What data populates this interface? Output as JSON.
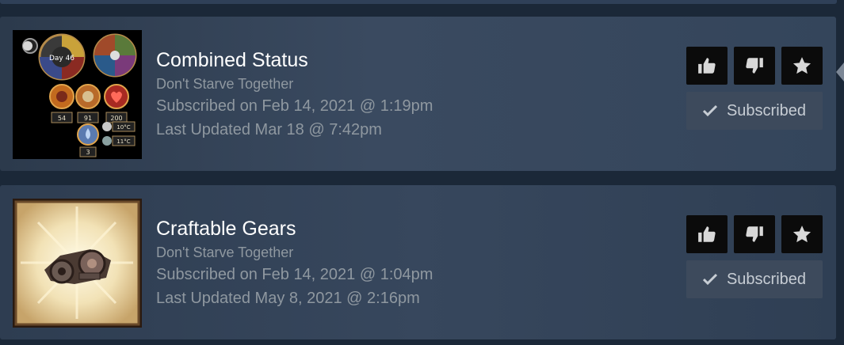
{
  "items": [
    {
      "title": "Combined Status",
      "game": "Don't Starve Together",
      "subscribed_on": "Subscribed on Feb 14, 2021 @ 1:19pm",
      "last_updated": "Last Updated Mar 18 @ 7:42pm",
      "subscribe_label": "Subscribed",
      "thumb": {
        "clock_text": "Day 46",
        "stat_values": [
          "54",
          "91",
          "200"
        ],
        "moisture_value": "3",
        "temps": [
          "10°C",
          "11°C"
        ]
      }
    },
    {
      "title": "Craftable Gears",
      "game": "Don't Starve Together",
      "subscribed_on": "Subscribed on Feb 14, 2021 @ 1:04pm",
      "last_updated": "Last Updated May 8, 2021 @ 2:16pm",
      "subscribe_label": "Subscribed"
    }
  ],
  "icons": {
    "vote_up": "thumbs-up-icon",
    "vote_down": "thumbs-down-icon",
    "favorite": "star-icon",
    "subscribed": "check-icon"
  },
  "colors": {
    "background": "#1b2838",
    "title": "#ffffff",
    "meta_text": "#8f98a0",
    "button_bg": "#0b0b0b",
    "subscribed_bg": "#3d4a5c"
  }
}
